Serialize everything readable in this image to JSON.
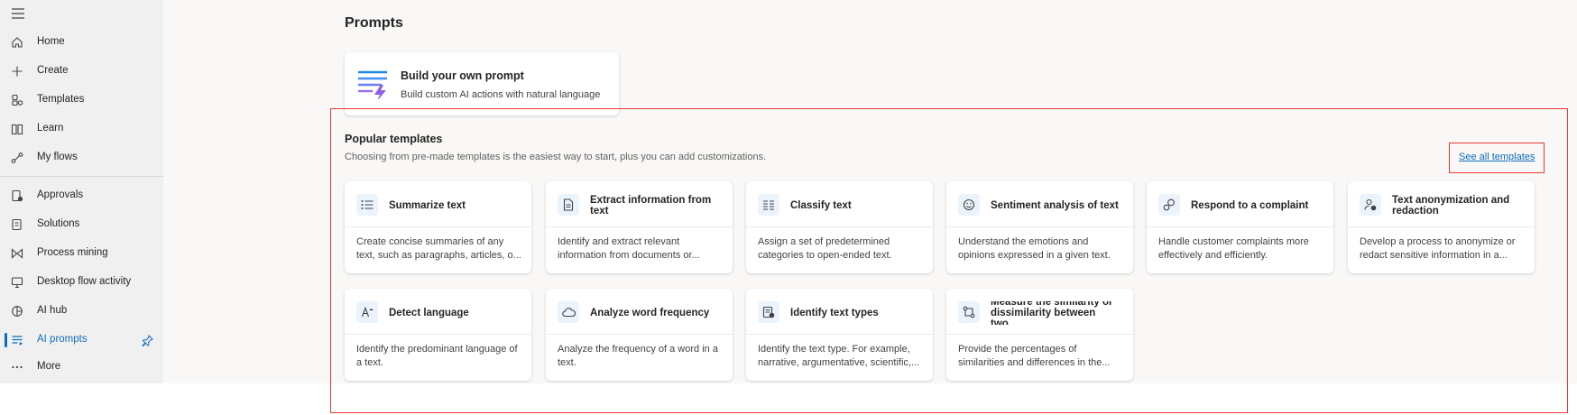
{
  "sidebar": {
    "items": [
      {
        "label": "Home",
        "icon": "home-icon"
      },
      {
        "label": "Create",
        "icon": "plus-icon"
      },
      {
        "label": "Templates",
        "icon": "templates-icon"
      },
      {
        "label": "Learn",
        "icon": "book-icon"
      },
      {
        "label": "My flows",
        "icon": "flow-icon"
      },
      {
        "label": "Approvals",
        "icon": "approvals-icon"
      },
      {
        "label": "Solutions",
        "icon": "solutions-icon"
      },
      {
        "label": "Process mining",
        "icon": "process-mining-icon"
      },
      {
        "label": "Desktop flow activity",
        "icon": "desktop-icon"
      },
      {
        "label": "AI hub",
        "icon": "ai-hub-icon"
      },
      {
        "label": "AI prompts",
        "icon": "ai-prompts-icon",
        "active": true
      },
      {
        "label": "More",
        "icon": "more-icon"
      }
    ]
  },
  "main": {
    "title": "Prompts",
    "build_card": {
      "title": "Build your own prompt",
      "description": "Build custom AI actions with natural language"
    },
    "popular": {
      "title": "Popular templates",
      "description": "Choosing from pre-made templates is the easiest way to start, plus you can add customizations.",
      "see_all": "See all templates",
      "cards": [
        {
          "title": "Summarize text",
          "description": "Create concise summaries of any text, such as paragraphs, articles, o...",
          "icon": "list-icon"
        },
        {
          "title": "Extract information from text",
          "description": "Identify and extract relevant information from documents or...",
          "icon": "document-icon"
        },
        {
          "title": "Classify text",
          "description": "Assign a set of predetermined categories to open-ended text.",
          "icon": "columns-icon"
        },
        {
          "title": "Sentiment analysis of text",
          "description": "Understand the emotions and opinions expressed in a given text.",
          "icon": "smiley-icon"
        },
        {
          "title": "Respond to a complaint",
          "description": "Handle customer complaints more effectively and efficiently.",
          "icon": "chat-gear-icon"
        },
        {
          "title": "Text anonymization and redaction",
          "description": "Develop a process to anonymize or redact sensitive information in a...",
          "icon": "person-lock-icon"
        },
        {
          "title": "Detect language",
          "description": "Identify the predominant language of a text.",
          "icon": "language-icon"
        },
        {
          "title": "Analyze word frequency",
          "description": "Analyze the frequency of a word in a text.",
          "icon": "cloud-icon"
        },
        {
          "title": "Identify text types",
          "description": "Identify the text type. For example, narrative, argumentative, scientific,...",
          "icon": "text-type-icon"
        },
        {
          "title": "Measure the similarity or dissimilarity between two...",
          "description": "Provide the percentages of similarities and differences in the...",
          "icon": "compare-icon"
        }
      ]
    }
  }
}
